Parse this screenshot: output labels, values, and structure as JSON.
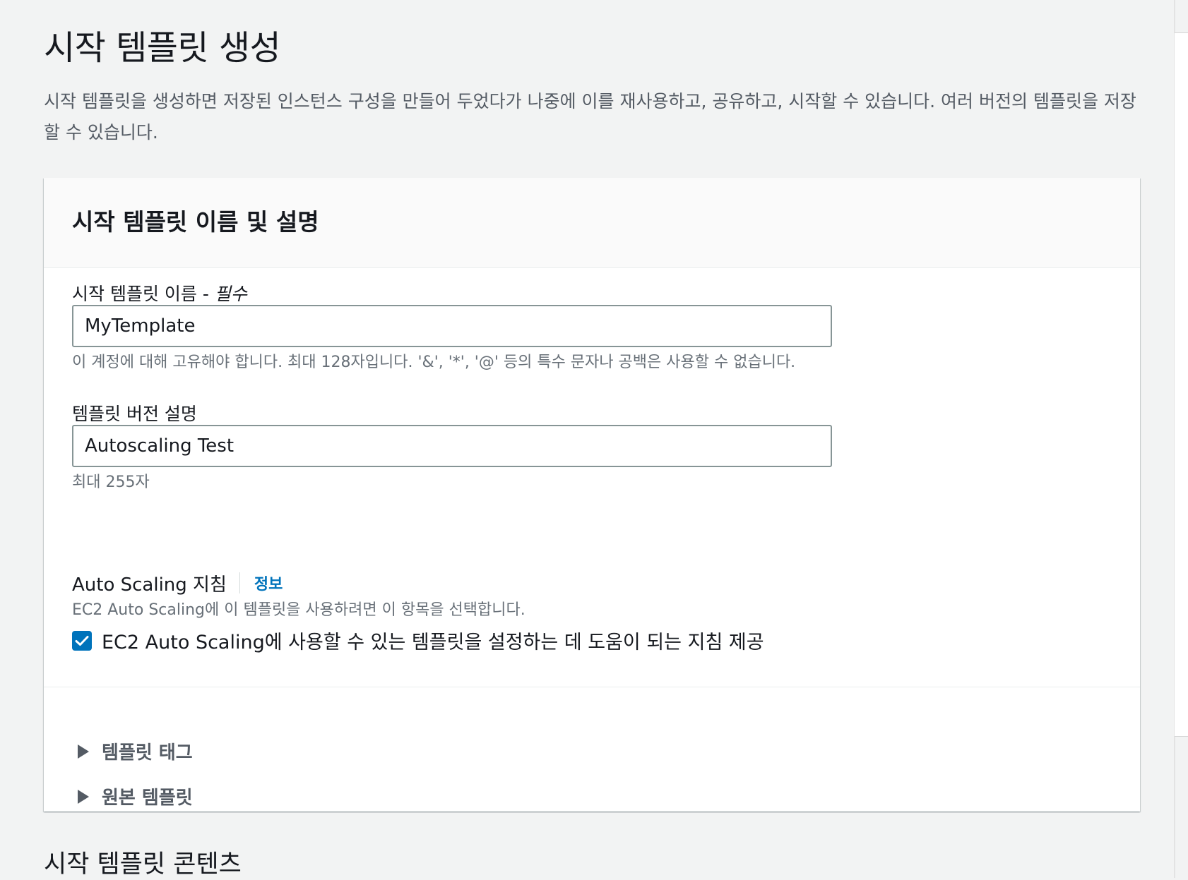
{
  "page": {
    "title": "시작 템플릿 생성",
    "description": "시작 템플릿을 생성하면 저장된 인스턴스 구성을 만들어 두었다가 나중에 이를 재사용하고, 공유하고, 시작할 수 있습니다. 여러 버전의 템플릿을 저장할 수 있습니다."
  },
  "panel": {
    "title": "시작 템플릿 이름 및 설명",
    "template_name": {
      "label": "시작 템플릿 이름 - ",
      "required_label": "필수",
      "value": "MyTemplate",
      "hint": "이 계정에 대해 고유해야 합니다. 최대 128자입니다. '&', '*', '@' 등의 특수 문자나 공백은 사용할 수 없습니다."
    },
    "version_description": {
      "label": "템플릿 버전 설명",
      "value": "Autoscaling Test",
      "hint": "최대 255자"
    },
    "autoscaling_guidance": {
      "label": "Auto Scaling 지침",
      "info_link": "정보",
      "description": "EC2 Auto Scaling에 이 템플릿을 사용하려면 이 항목을 선택합니다.",
      "checkbox_label": "EC2 Auto Scaling에 사용할 수 있는 템플릿을 설정하는 데 도움이 되는 지침 제공",
      "checked": true
    },
    "expanders": [
      {
        "label": "템플릿 태그"
      },
      {
        "label": "원본 템플릿"
      }
    ]
  },
  "next_section": {
    "title": "시작 템플릿 콘텐츠"
  },
  "colors": {
    "background": "#f2f3f3",
    "accent": "#0073bb",
    "text": "#16191f",
    "secondary_text": "#687078"
  },
  "icons": {
    "checkbox": "checkmark-icon",
    "expander": "caret-right-icon"
  }
}
